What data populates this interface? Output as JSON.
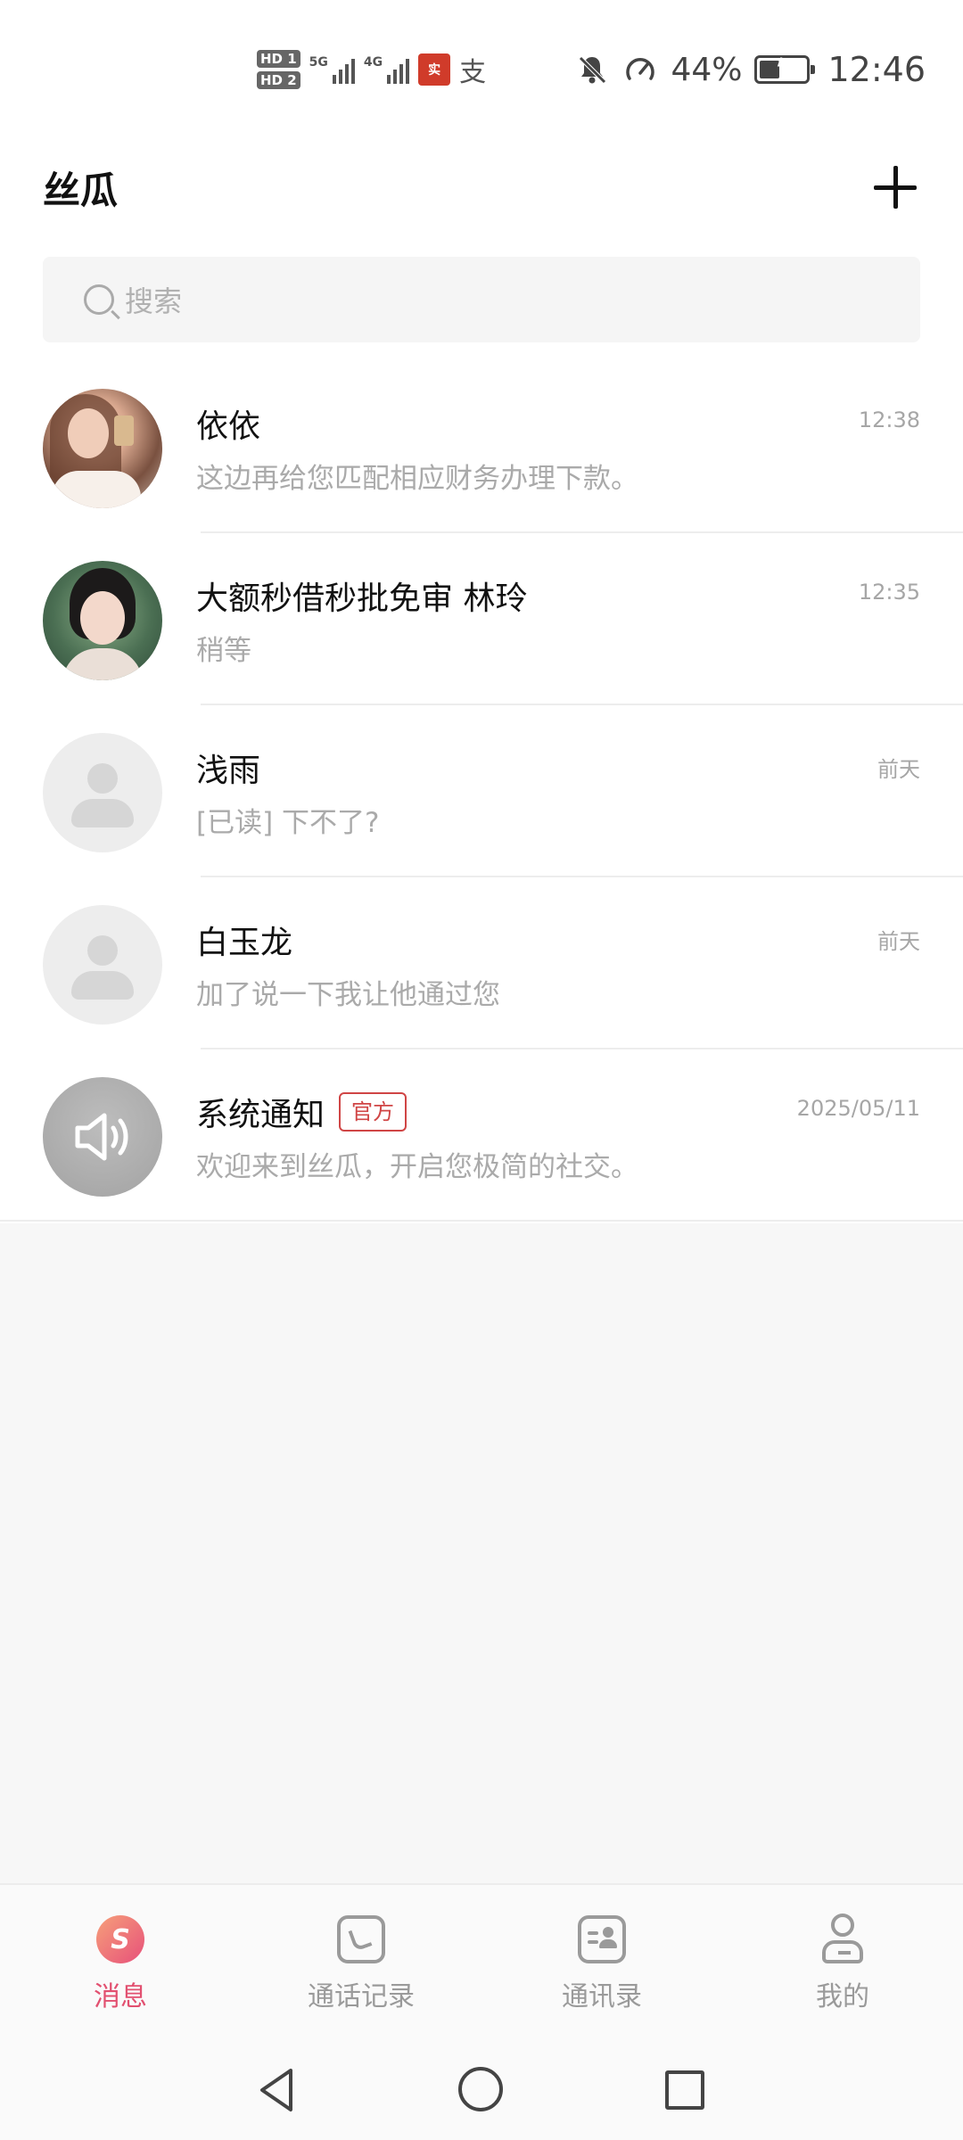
{
  "status_bar": {
    "hd1": "HD 1",
    "hd2": "HD 2",
    "net1": "5G",
    "net2": "4G",
    "app_badge": "实",
    "alipay": "支",
    "battery_percent": "44%",
    "battery_level": 0.44,
    "time": "12:46"
  },
  "header": {
    "title": "丝瓜"
  },
  "search": {
    "placeholder": "搜索"
  },
  "chats": [
    {
      "name": "依依",
      "preview": "这边再给您匹配相应财务办理下款。",
      "time": "12:38",
      "avatar": "photo"
    },
    {
      "name": "大额秒借秒批免审 林玲",
      "preview": "稍等",
      "time": "12:35",
      "avatar": "photo"
    },
    {
      "name": "浅雨",
      "preview": "[已读] 下不了?",
      "time": "前天",
      "avatar": "default"
    },
    {
      "name": "白玉龙",
      "preview": "加了说一下我让他通过您",
      "time": "前天",
      "avatar": "default"
    },
    {
      "name": "系统通知",
      "badge": "官方",
      "preview": "欢迎来到丝瓜，开启您极简的社交。",
      "time": "2025/05/11",
      "avatar": "speaker-icon"
    }
  ],
  "tabs": [
    {
      "label": "消息",
      "icon": "message-icon",
      "active": true
    },
    {
      "label": "通话记录",
      "icon": "call-log-icon",
      "active": false
    },
    {
      "label": "通讯录",
      "icon": "contacts-icon",
      "active": false
    },
    {
      "label": "我的",
      "icon": "profile-icon",
      "active": false
    }
  ],
  "colors": {
    "accent": "#e25070",
    "official_badge": "#d04545"
  }
}
